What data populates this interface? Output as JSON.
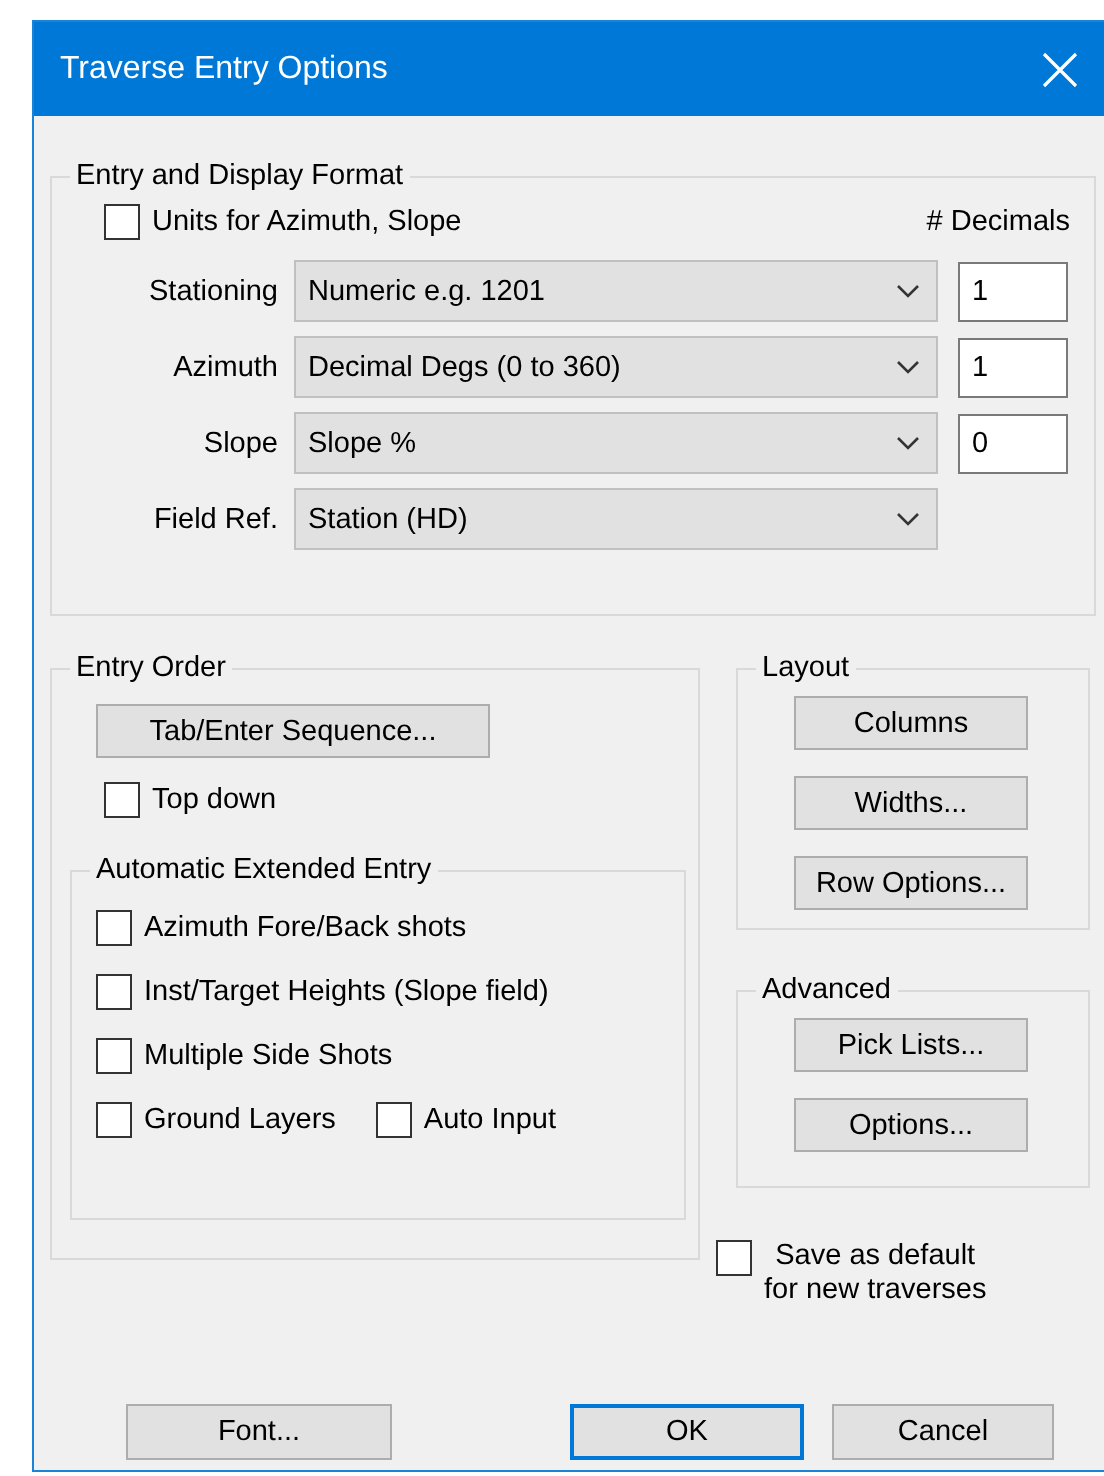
{
  "window": {
    "title": "Traverse Entry Options"
  },
  "entry_display": {
    "title": "Entry and Display Format",
    "units_checkbox": {
      "label": "Units for Azimuth, Slope",
      "checked": false
    },
    "decimals_heading": "# Decimals",
    "rows": [
      {
        "label": "Stationing",
        "value": "Numeric e.g. 1201",
        "decimals": "1"
      },
      {
        "label": "Azimuth",
        "value": "Decimal Degs (0 to 360)",
        "decimals": "1"
      },
      {
        "label": "Slope",
        "value": "Slope %",
        "decimals": "0"
      },
      {
        "label": "Field Ref.",
        "value": "Station (HD)"
      }
    ]
  },
  "entry_order": {
    "title": "Entry Order",
    "button": "Tab/Enter Sequence...",
    "top_down": {
      "label": "Top down",
      "checked": false
    },
    "automatic": {
      "title": "Automatic Extended Entry",
      "rows": [
        [
          {
            "label": "Azimuth Fore/Back shots",
            "checked": false
          }
        ],
        [
          {
            "label": "Inst/Target Heights (Slope field)",
            "checked": false
          }
        ],
        [
          {
            "label": "Multiple Side Shots",
            "checked": false
          }
        ],
        [
          {
            "label": "Ground Layers",
            "checked": false
          },
          {
            "label": "Auto Input",
            "checked": false
          }
        ]
      ]
    }
  },
  "layout": {
    "title": "Layout",
    "buttons": [
      "Columns",
      "Widths...",
      "Row Options..."
    ]
  },
  "advanced": {
    "title": "Advanced",
    "buttons": [
      "Pick Lists...",
      "Options..."
    ]
  },
  "save_default": {
    "label": "Save as default\nfor new traverses",
    "checked": false
  },
  "footer_buttons": [
    {
      "label": "Font...",
      "default": false
    },
    {
      "label": "OK",
      "default": true
    },
    {
      "label": "Cancel",
      "default": false
    }
  ]
}
